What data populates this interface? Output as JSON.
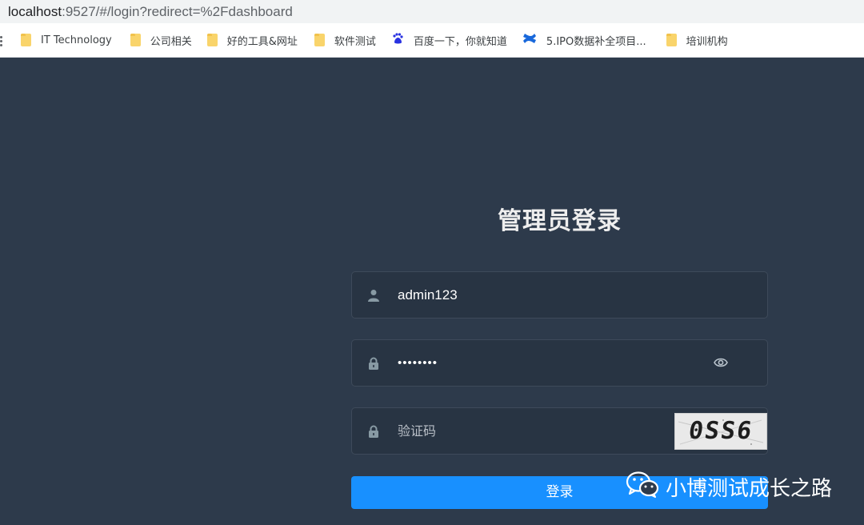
{
  "browser": {
    "url_host": "localhost",
    "url_path": ":9527/#/login?redirect=%2Fdashboard"
  },
  "bookmarks": [
    {
      "label": "IT Technology",
      "icon": "folder-icon"
    },
    {
      "label": "公司相关",
      "icon": "folder-icon"
    },
    {
      "label": "好的工具&网址",
      "icon": "folder-icon"
    },
    {
      "label": "软件测试",
      "icon": "folder-icon"
    },
    {
      "label": "百度一下，你就知道",
      "icon": "baidu-icon"
    },
    {
      "label": "5.IPO数据补全项目...",
      "icon": "confluence-icon"
    },
    {
      "label": "培训机构",
      "icon": "folder-icon"
    }
  ],
  "login": {
    "title": "管理员登录",
    "username": {
      "value": "admin123",
      "icon": "user-icon"
    },
    "password": {
      "value": "••••••••",
      "icon": "lock-icon",
      "toggle_icon": "eye-icon"
    },
    "captcha": {
      "placeholder": "验证码",
      "icon": "lock-icon",
      "image_text": "0SS6"
    },
    "submit_label": "登录"
  },
  "watermark": {
    "text": "小博测试成长之路",
    "icon": "wechat-icon"
  },
  "colors": {
    "background": "#2d3a4b",
    "field_bg": "#283443",
    "button": "#1890ff",
    "title": "#eeeeee"
  }
}
